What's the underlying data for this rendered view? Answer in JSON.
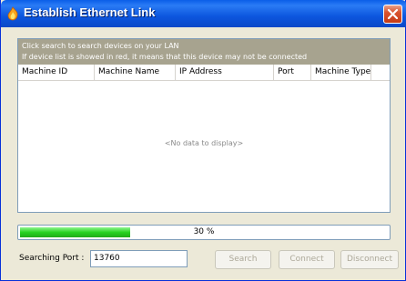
{
  "window": {
    "title": "Establish Ethernet Link",
    "icon": "app-flame-icon",
    "close_icon": "close-icon",
    "colors": {
      "titlebar": "#0a5ee8",
      "close": "#d9532e",
      "notice_bg": "#a7a38f",
      "progress": "#26d21f"
    }
  },
  "notice": {
    "line1": "Click search to search devices on your LAN",
    "line2": "If device list is showed in red, it means that this device may not be connected"
  },
  "table": {
    "columns": [
      "Machine ID",
      "Machine Name",
      "IP Address",
      "Port",
      "Machine Type"
    ],
    "empty_text": "<No data to display>"
  },
  "progress": {
    "percent": 30,
    "label": "30 %"
  },
  "port": {
    "label": "Searching Port :",
    "value": "13760"
  },
  "buttons": {
    "search": "Search",
    "connect": "Connect",
    "disconnect": "Disconnect"
  }
}
